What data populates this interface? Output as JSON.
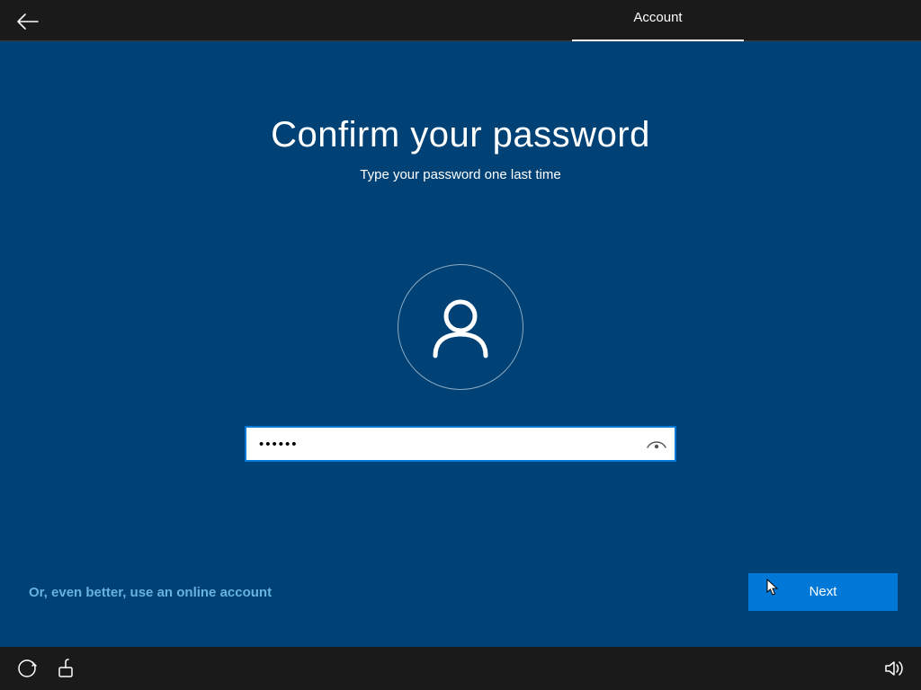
{
  "topbar": {
    "tab_label": "Account"
  },
  "page": {
    "title": "Confirm your password",
    "subtitle": "Type your password one last time"
  },
  "password": {
    "masked_value": "••••••"
  },
  "link": {
    "online_account": "Or, even better, use an online account"
  },
  "buttons": {
    "next": "Next"
  }
}
